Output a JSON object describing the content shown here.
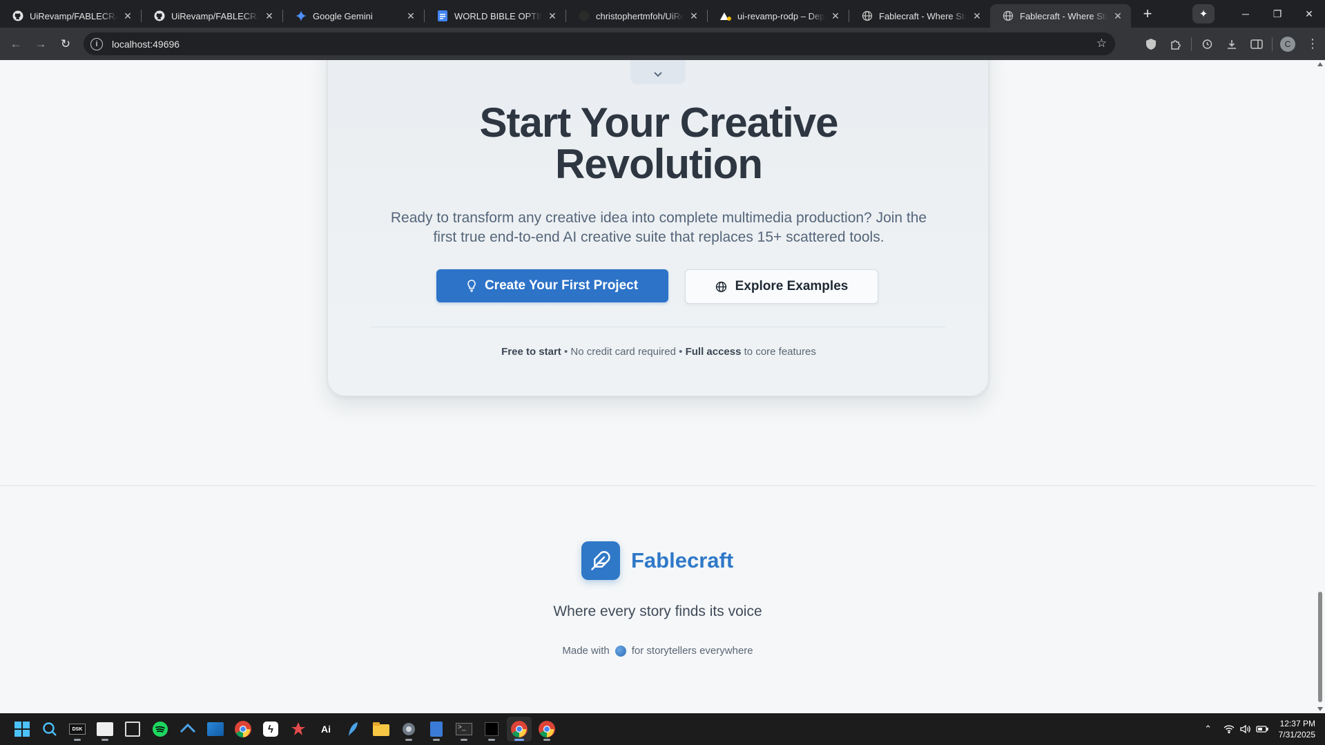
{
  "browser": {
    "tabs": [
      {
        "title": "UiRevamp/FABLECRAFT_",
        "icon": "github-icon"
      },
      {
        "title": "UiRevamp/FABLECRAFT_",
        "icon": "github-icon"
      },
      {
        "title": "Google Gemini",
        "icon": "gemini-icon"
      },
      {
        "title": "WORLD BIBLE OPTIMIZE",
        "icon": "google-docs-icon"
      },
      {
        "title": "christophertmfoh/UiRev",
        "icon": "github-icon"
      },
      {
        "title": "ui-revamp-rodp – Deplo",
        "icon": "vercel-icon"
      },
      {
        "title": "Fablecraft - Where Storie",
        "icon": "globe-icon"
      },
      {
        "title": "Fablecraft - Where Storie",
        "icon": "globe-icon",
        "active": true
      }
    ],
    "url": "localhost:49696",
    "avatar_letter": "C"
  },
  "cta": {
    "title_line1": "Start Your Creative",
    "title_line2": "Revolution",
    "subtitle": "Ready to transform any creative idea into complete multimedia production? Join the first true end-to-end AI creative suite that replaces 15+ scattered tools.",
    "primary_button": "Create Your First Project",
    "secondary_button": "Explore Examples",
    "note": {
      "part1_bold": "Free to start",
      "sep1": " • ",
      "part2": "No credit card required",
      "sep2": " • ",
      "part3_bold": "Full access",
      "part4": " to core features"
    }
  },
  "footer": {
    "brand_name": "Fablecraft",
    "tagline": "Where every story finds its voice",
    "made_with_prefix": "Made with",
    "made_with_suffix": "for storytellers everywhere"
  },
  "taskbar": {
    "apps": [
      "windows-start-icon",
      "search-icon",
      "dsk-icon",
      "cloud-app-icon",
      "exe-app-icon",
      "spotify-icon",
      "vscode-icon",
      "photos-icon",
      "chrome-icon",
      "bolt-app-icon",
      "red-app-icon",
      "ai-app-icon",
      "feather-app-icon",
      "file-explorer-icon",
      "settings-icon",
      "notepad-icon",
      "terminal-icon",
      "cursor-app-icon",
      "chrome-active-icon",
      "chrome-alt-icon"
    ],
    "time": "12:37 PM",
    "date": "7/31/2025"
  },
  "colors": {
    "accent": "#2d73c8",
    "brand": "#2f78c8",
    "chrome_dark": "#202124",
    "chrome_toolbar": "#35363a",
    "page_bg": "#f5f7f8"
  }
}
